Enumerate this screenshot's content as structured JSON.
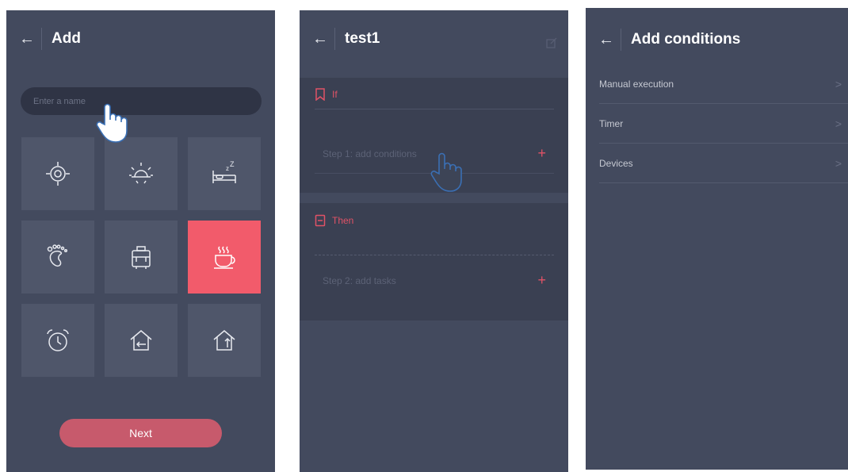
{
  "screen_add": {
    "back_icon": "←",
    "title": "Add",
    "name_placeholder": "Enter a name",
    "icons": [
      "gear-sun-icon",
      "sun-icon",
      "bed-sleep-icon",
      "footprint-icon",
      "luggage-icon",
      "coffee-cup-icon",
      "alarm-clock-icon",
      "home-enter-icon",
      "home-leave-icon"
    ],
    "selected_icon": "coffee-cup-icon",
    "next_label": "Next",
    "accent": "#f25b6b"
  },
  "screen_test1": {
    "back_icon": "←",
    "title": "test1",
    "if_label": "If",
    "step1_label": "Step 1: add conditions",
    "then_label": "Then",
    "step2_label": "Step 2: add tasks",
    "plus": "+"
  },
  "screen_conditions": {
    "back_icon": "←",
    "title": "Add conditions",
    "items": [
      {
        "label": "Manual execution",
        "chevron": ">"
      },
      {
        "label": "Timer",
        "chevron": ">"
      },
      {
        "label": "Devices",
        "chevron": ">"
      }
    ]
  }
}
